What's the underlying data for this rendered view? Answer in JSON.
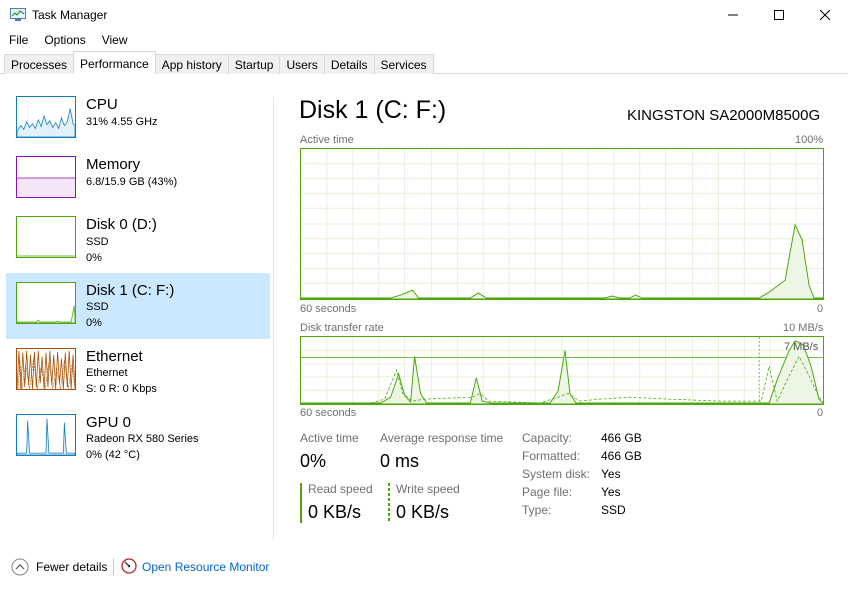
{
  "window": {
    "title": "Task Manager"
  },
  "menu": [
    "File",
    "Options",
    "View"
  ],
  "tabs": [
    "Processes",
    "Performance",
    "App history",
    "Startup",
    "Users",
    "Details",
    "Services"
  ],
  "active_tab": "Performance",
  "sidebar": {
    "items": [
      {
        "title": "CPU",
        "lines": [
          "31% 4.55 GHz"
        ],
        "color": "#117dbb"
      },
      {
        "title": "Memory",
        "lines": [
          "6.8/15.9 GB (43%)"
        ],
        "color": "#8b12ae"
      },
      {
        "title": "Disk 0 (D:)",
        "lines": [
          "SSD",
          "0%"
        ],
        "color": "#4da60c"
      },
      {
        "title": "Disk 1 (C: F:)",
        "lines": [
          "SSD",
          "0%"
        ],
        "color": "#4da60c"
      },
      {
        "title": "Ethernet",
        "lines": [
          "Ethernet",
          "S: 0 R: 0 Kbps"
        ],
        "color": "#a74f01"
      },
      {
        "title": "GPU 0",
        "lines": [
          "Radeon RX 580 Series",
          "0% (42 °C)"
        ],
        "color": "#117dbb"
      }
    ],
    "selected": "Disk 1 (C: F:)"
  },
  "main": {
    "title": "Disk 1 (C: F:)",
    "model": "KINGSTON SA2000M8500G",
    "graph1": {
      "label": "Active time",
      "max_label": "100%",
      "time_label": "60 seconds",
      "min_label": "0"
    },
    "graph2": {
      "label": "Disk transfer rate",
      "max_label": "10 MB/s",
      "marker_label": "7 MB/s",
      "time_label": "60 seconds",
      "min_label": "0"
    },
    "stats": {
      "active_time_label": "Active time",
      "active_time_value": "0%",
      "avg_response_label": "Average response time",
      "avg_response_value": "0 ms",
      "read_speed_label": "Read speed",
      "read_speed_value": "0 KB/s",
      "write_speed_label": "Write speed",
      "write_speed_value": "0 KB/s"
    },
    "details": [
      {
        "label": "Capacity:",
        "value": "466 GB"
      },
      {
        "label": "Formatted:",
        "value": "466 GB"
      },
      {
        "label": "System disk:",
        "value": "Yes"
      },
      {
        "label": "Page file:",
        "value": "Yes"
      },
      {
        "label": "Type:",
        "value": "SSD"
      }
    ]
  },
  "footer": {
    "fewer_details": "Fewer details",
    "open_resource_monitor": "Open Resource Monitor"
  },
  "colors": {
    "disk_green": "#4da60c",
    "selection": "#cce8ff",
    "link_blue": "#0066cc"
  }
}
